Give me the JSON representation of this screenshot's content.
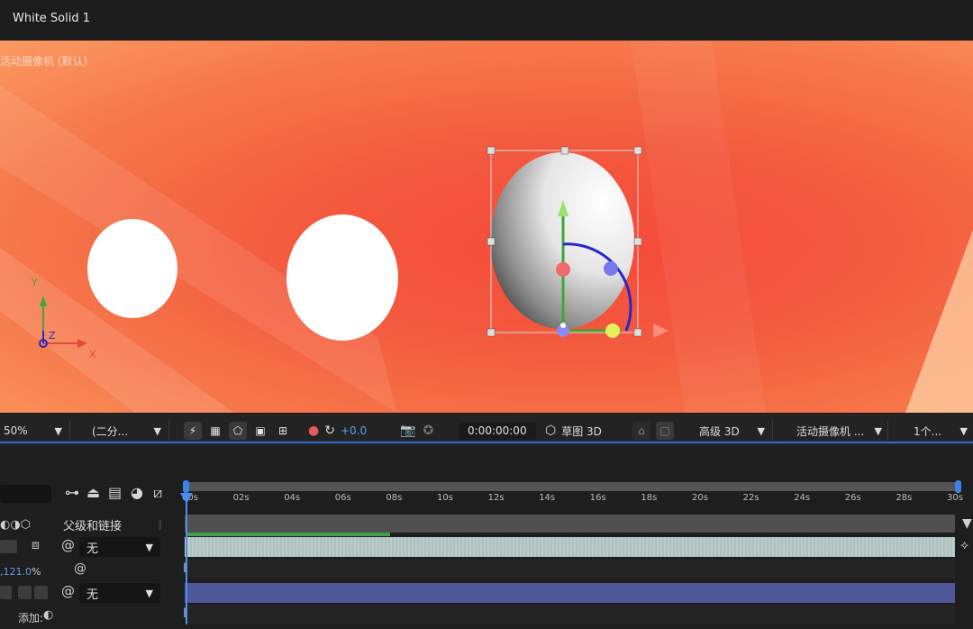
{
  "window": {
    "title": "White Solid 1"
  },
  "viewer": {
    "camera_label": "活动摄像机 (默认)",
    "axis": {
      "y": "Y",
      "z": "Z",
      "x": "X"
    }
  },
  "viewer_toolbar": {
    "zoom": "50%",
    "resolution": "(二分...",
    "exposure": "+0.0",
    "timecode": "0:00:00:00",
    "draft_3d": "草图 3D",
    "renderer": "高级 3D",
    "camera": "活动摄像机 ...",
    "views": "1个..."
  },
  "timeline": {
    "ticks": [
      "00s",
      "02s",
      "04s",
      "06s",
      "08s",
      "10s",
      "12s",
      "14s",
      "16s",
      "18s",
      "20s",
      "22s",
      "24s",
      "26s",
      "28s",
      "30s"
    ],
    "parent_header": "父级和链接",
    "layers": [
      {
        "parent": "无"
      },
      {
        "parent": "无"
      }
    ],
    "scale_value": "121.0",
    "scale_unit": "%",
    "add_label": "添加:"
  },
  "colors": {
    "accent": "#2f6bd8",
    "viewer_bg": "#f5583e",
    "layer1": "#b4c8c6",
    "layer2": "#4e5898",
    "work_bar": "#3fa14b"
  },
  "icons": [
    "camera-icon",
    "snapshot-icon",
    "color-channels-icon",
    "reset-exposure-icon",
    "transparency-grid-icon",
    "mask-icon",
    "draft-3d-icon",
    "parent-pickwhip-icon"
  ]
}
